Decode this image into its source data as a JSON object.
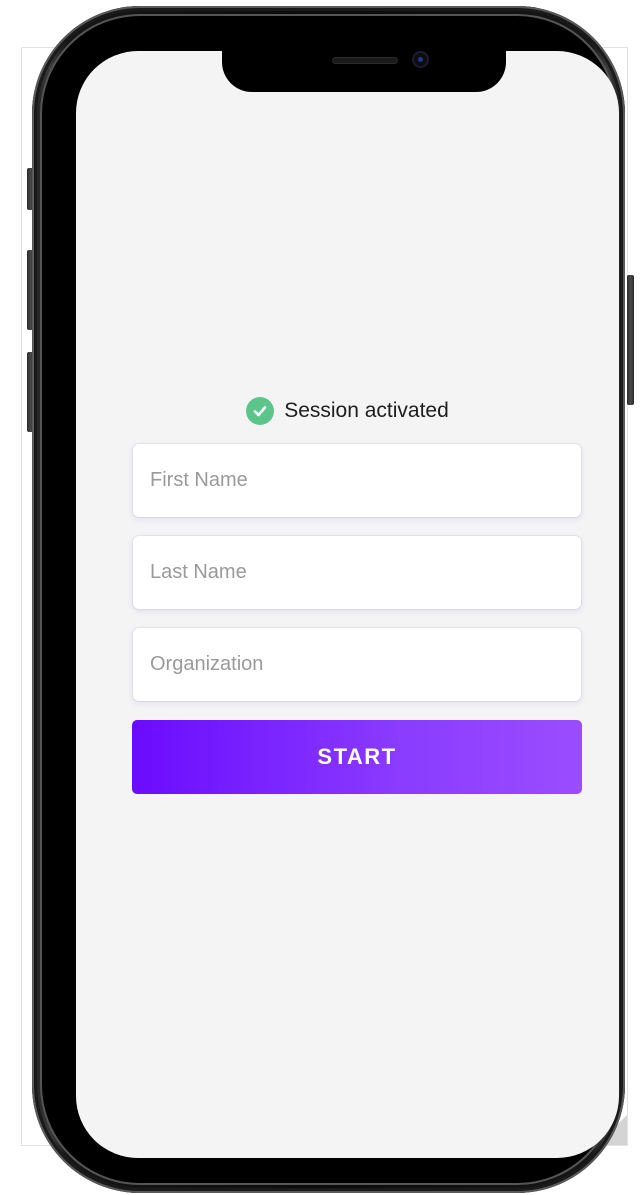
{
  "status": {
    "icon": "check-circle-icon",
    "text": "Session activated",
    "color": "#5cc58a"
  },
  "form": {
    "first_name": {
      "value": "",
      "placeholder": "First Name"
    },
    "last_name": {
      "value": "",
      "placeholder": "Last Name"
    },
    "organization": {
      "value": "",
      "placeholder": "Organization"
    },
    "submit_label": "START",
    "accent_start": "#6b0bff",
    "accent_end": "#9a4dff"
  },
  "screen_background": "#f4f4f5"
}
